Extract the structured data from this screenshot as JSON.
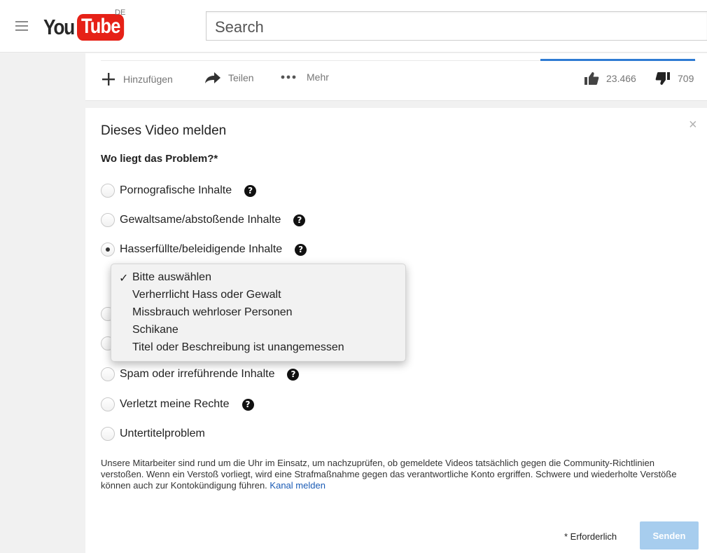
{
  "masthead": {
    "logo_you": "You",
    "logo_tube": "Tube",
    "country": "DE",
    "search_placeholder": "Search"
  },
  "actions": {
    "add_label": "Hinzufügen",
    "share_label": "Teilen",
    "more_label": "Mehr",
    "likes": "23.466",
    "dislikes": "709"
  },
  "report": {
    "title": "Dieses Video melden",
    "question": "Wo liegt das Problem?*",
    "options": [
      {
        "label": "Pornografische Inhalte",
        "help": "?"
      },
      {
        "label": "Gewaltsame/abstoßende Inhalte",
        "help": "?"
      },
      {
        "label": "Hasserfüllte/beleidigende Inhalte",
        "help": "?"
      },
      {
        "label": "Spam oder irreführende Inhalte",
        "help": "?"
      },
      {
        "label": "Verletzt meine Rechte",
        "help": "?"
      },
      {
        "label": "Untertitelproblem"
      }
    ],
    "dropdown": {
      "check": "✓",
      "items": [
        "Bitte auswählen",
        "Verherrlicht Hass oder Gewalt",
        "Missbrauch wehrloser Personen",
        "Schikane",
        "Titel oder Beschreibung ist unangemessen"
      ]
    },
    "notice_text": "Unsere Mitarbeiter sind rund um die Uhr im Einsatz, um nachzuprüfen, ob gemeldete Videos tatsächlich gegen die Community-Richtlinien verstoßen. Wenn ein Verstoß vorliegt, wird eine Strafmaßnahme gegen das verantwortliche Konto ergriffen. Schwere und wiederholte Verstöße können auch zur Kontokündigung führen.",
    "notice_link": "Kanal melden",
    "required_note": "* Erforderlich",
    "submit_label": "Senden",
    "close_symbol": "×"
  },
  "colors": {
    "brand_red": "#e62117",
    "accent_blue": "#2f7bd3",
    "link_blue": "#1a5bb5",
    "submit_disabled": "#a7cdee"
  }
}
